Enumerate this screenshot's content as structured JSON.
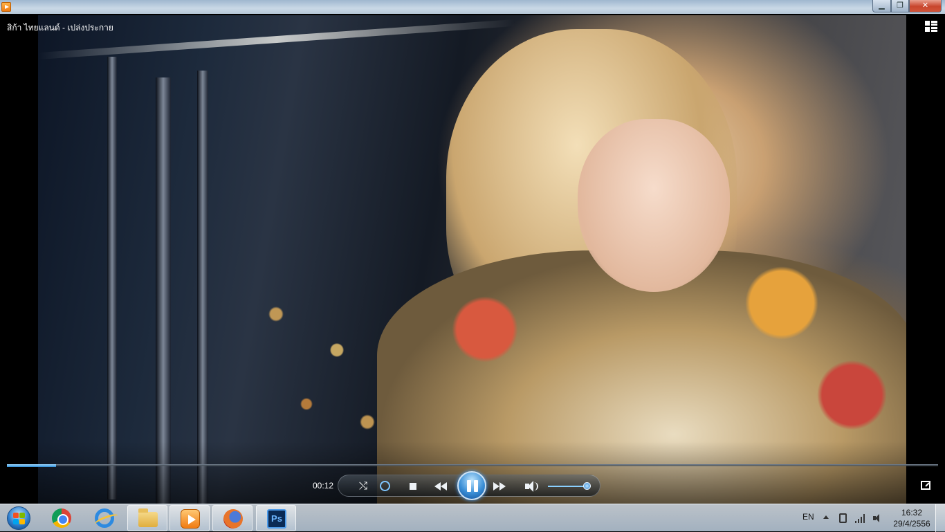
{
  "window": {
    "video_title": "สิก้า ไทยแลนด์ - เปล่งประกาย",
    "caption_buttons": {
      "minimize": "▁",
      "maximize": "❐",
      "close": "✕"
    }
  },
  "video": {
    "description_icon": "video-frame",
    "seek_progress": 0.053
  },
  "controls": {
    "time_elapsed": "00:12",
    "shuffle_glyph": "⤭",
    "volume_level": 0.9,
    "accent_color": "#3b8fd6"
  },
  "taskbar": {
    "pinned": [
      "chrome-icon",
      "ie-icon",
      "explorer-icon",
      "wmp-icon",
      "firefox-icon",
      "ps-icon"
    ],
    "ps_label": "Ps",
    "language": "EN",
    "clock_time": "16:32",
    "clock_date": "29/4/2556"
  }
}
